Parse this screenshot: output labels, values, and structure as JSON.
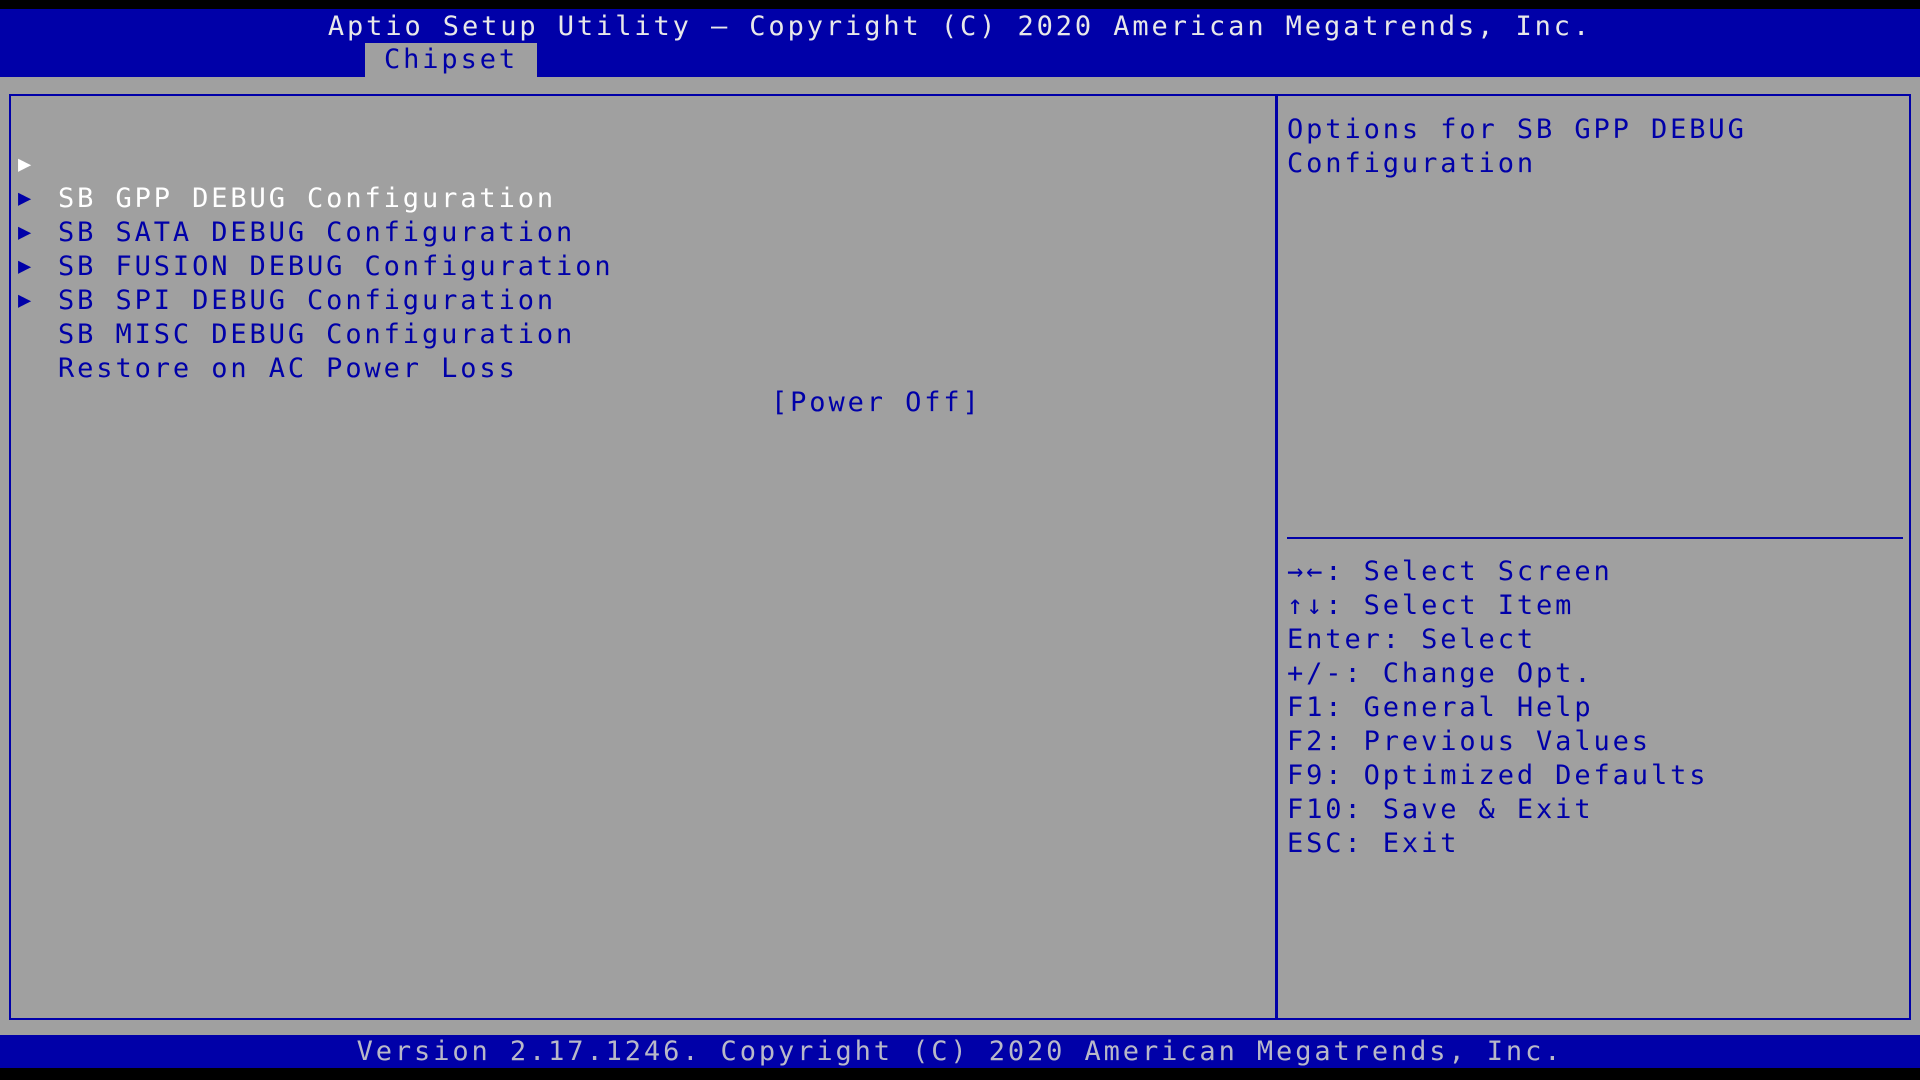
{
  "header": {
    "title": "Aptio Setup Utility – Copyright (C) 2020 American Megatrends, Inc.",
    "active_tab": "Chipset"
  },
  "menu": {
    "items": [
      {
        "label": "SB GPP DEBUG Configuration",
        "type": "submenu",
        "selected": true
      },
      {
        "label": "SB SATA DEBUG Configuration",
        "type": "submenu",
        "selected": false
      },
      {
        "label": "SB FUSION DEBUG Configuration",
        "type": "submenu",
        "selected": false
      },
      {
        "label": "SB SPI DEBUG Configuration",
        "type": "submenu",
        "selected": false
      },
      {
        "label": "SB MISC DEBUG Configuration",
        "type": "submenu",
        "selected": false
      }
    ],
    "settings": [
      {
        "label": "Restore on AC Power Loss",
        "value": "[Power Off]"
      }
    ],
    "submenu_icon": "▶"
  },
  "help": {
    "text": "Options for SB GPP DEBUG Configuration",
    "keys": [
      "→←: Select Screen",
      "↑↓: Select Item",
      "Enter: Select",
      "+/-: Change Opt.",
      "F1: General Help",
      "F2: Previous Values",
      "F9: Optimized Defaults",
      "F10: Save & Exit",
      "ESC: Exit"
    ]
  },
  "footer": {
    "text": "Version 2.17.1246. Copyright (C) 2020 American Megatrends, Inc."
  },
  "colors": {
    "header_bg": "#0000a8",
    "panel_bg": "#a0a0a0",
    "text": "#0000a8",
    "selected_text": "#ffffff"
  }
}
